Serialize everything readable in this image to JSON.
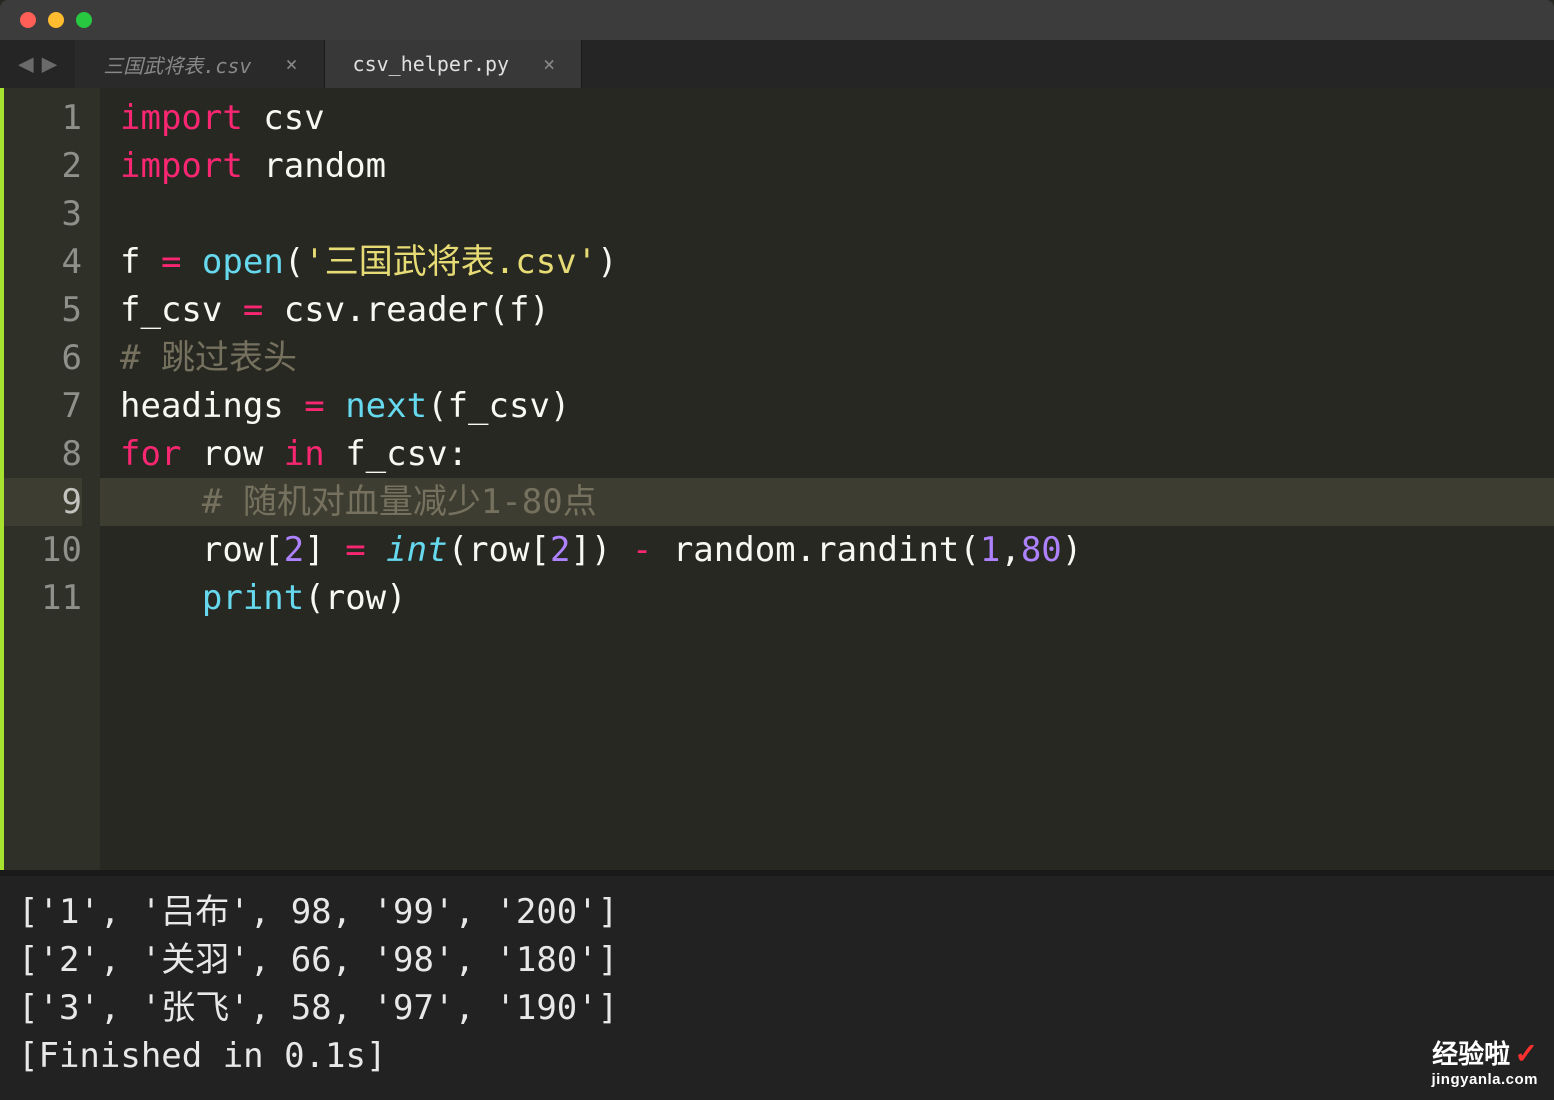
{
  "tabs": [
    {
      "label": "三国武将表.csv",
      "active": false
    },
    {
      "label": "csv_helper.py",
      "active": true
    }
  ],
  "nav": {
    "back": "◀",
    "forward": "▶",
    "close": "×"
  },
  "gutter": [
    "1",
    "2",
    "3",
    "4",
    "5",
    "6",
    "7",
    "8",
    "9",
    "10",
    "11"
  ],
  "active_line_index": 8,
  "code": {
    "l1": {
      "a": "import",
      "b": " csv"
    },
    "l2": {
      "a": "import",
      "b": " random"
    },
    "l4": {
      "a": "f ",
      "b": "=",
      "c": " ",
      "d": "open",
      "e": "(",
      "f": "'三国武将表.csv'",
      "g": ")"
    },
    "l5": {
      "a": "f_csv ",
      "b": "=",
      "c": " csv.reader(f)"
    },
    "l6": {
      "a": "# 跳过表头"
    },
    "l7": {
      "a": "headings ",
      "b": "=",
      "c": " ",
      "d": "next",
      "e": "(f_csv)"
    },
    "l8": {
      "a": "for",
      "b": " row ",
      "c": "in",
      "d": " f_csv:"
    },
    "l9": {
      "a": "    ",
      "b": "# 随机对血量减少1-80点"
    },
    "l10": {
      "a": "    row[",
      "b": "2",
      "c": "] ",
      "d": "=",
      "e": " ",
      "f": "int",
      "g": "(row[",
      "h": "2",
      "i": "]) ",
      "j": "-",
      "k": " random.randint(",
      "l": "1",
      "m": ",",
      "n": "80",
      "o": ")"
    },
    "l11": {
      "a": "    ",
      "b": "print",
      "c": "(row)"
    }
  },
  "console_lines": [
    "['1', '吕布', 98, '99', '200']",
    "['2', '关羽', 66, '98', '180']",
    "['3', '张飞', 58, '97', '190']",
    "[Finished in 0.1s]"
  ],
  "watermark": {
    "main": "经验啦",
    "check": "✓",
    "sub": "jingyanla.com"
  }
}
